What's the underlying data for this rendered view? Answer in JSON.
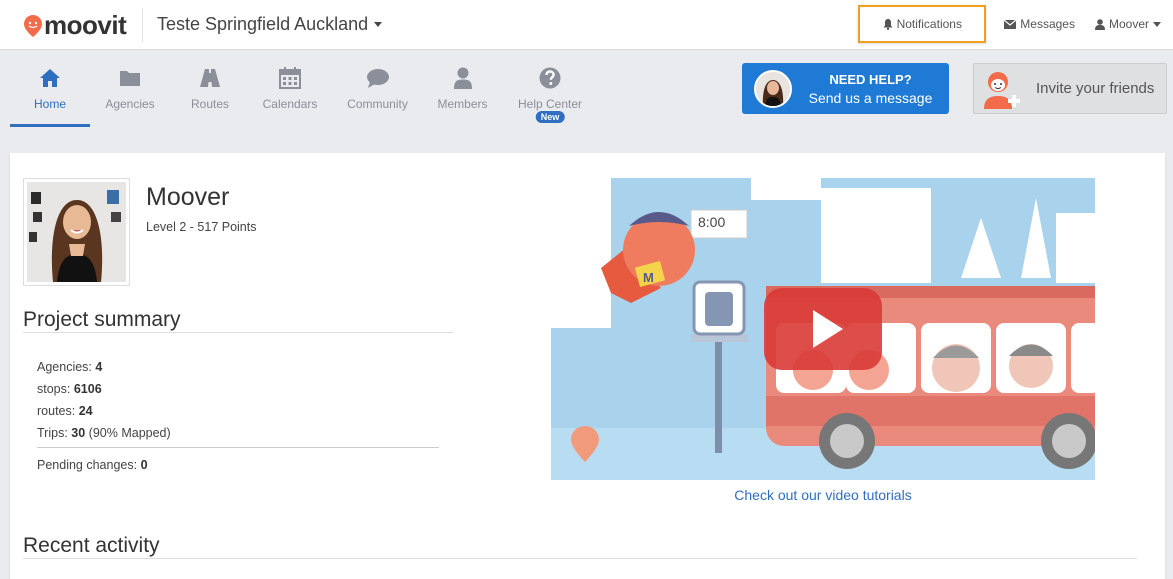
{
  "header": {
    "logo_text": "moovit",
    "project_name": "Teste Springfield Auckland",
    "notifications_label": "Notifications",
    "messages_label": "Messages",
    "user_label": "Moover"
  },
  "nav": {
    "items": [
      {
        "label": "Home",
        "icon": "home-icon",
        "active": true
      },
      {
        "label": "Agencies",
        "icon": "folder-icon"
      },
      {
        "label": "Routes",
        "icon": "road-icon"
      },
      {
        "label": "Calendars",
        "icon": "calendar-icon"
      },
      {
        "label": "Community",
        "icon": "chat-bubble-icon"
      },
      {
        "label": "Members",
        "icon": "user-icon"
      },
      {
        "label": "Help Center",
        "icon": "question-icon",
        "badge": "New"
      }
    ],
    "help_button": {
      "line1": "NEED HELP?",
      "line2": "Send us a message"
    },
    "invite_button": "Invite your friends"
  },
  "profile": {
    "name": "Moover",
    "level": "Level 2 - 517 Points"
  },
  "project_summary": {
    "title": "Project summary",
    "agencies_label": "Agencies:",
    "agencies_value": "4",
    "stops_label": "stops:",
    "stops_value": "6106",
    "routes_label": "routes:",
    "routes_value": "24",
    "trips_label": "Trips:",
    "trips_value": "30",
    "trips_mapped": "(90% Mapped)",
    "pending_label": "Pending changes:",
    "pending_value": "0"
  },
  "video": {
    "clock_time": "8:00",
    "mascot_letter": "M",
    "link_text": "Check out our video tutorials"
  },
  "recent_activity": {
    "title": "Recent activity"
  },
  "colors": {
    "accent": "#2f6fbf",
    "brand_orange": "#f26b4a",
    "highlight": "#f0a020",
    "help_blue": "#1f7ad6"
  }
}
